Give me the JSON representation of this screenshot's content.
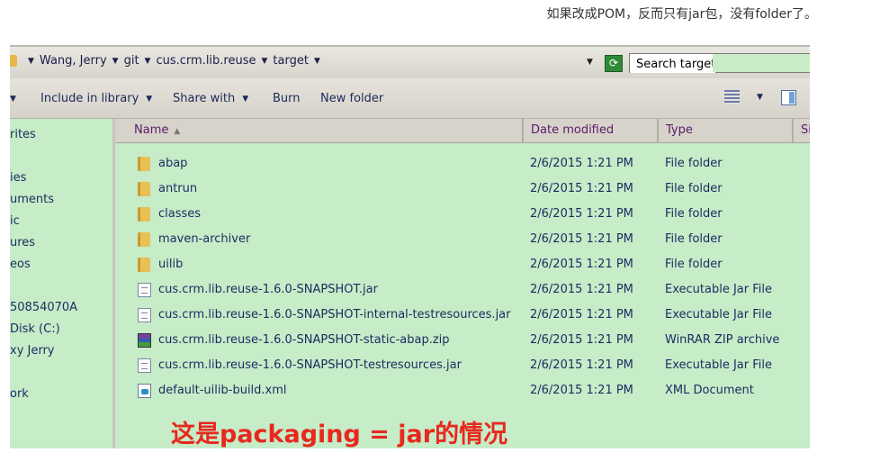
{
  "caption": "如果改成POM，反而只有jar包，没有folder了。",
  "address": {
    "crumbs": [
      "Wang, Jerry",
      "git",
      "cus.crm.lib.reuse",
      "target"
    ],
    "search_placeholder": "Search target"
  },
  "toolbar": {
    "include_in_library": "Include in library",
    "share_with": "Share with",
    "burn": "Burn",
    "new_folder": "New folder"
  },
  "nav": {
    "items": [
      "rites",
      "ies",
      "uments",
      "ic",
      "ures",
      "eos",
      "50854070A",
      "Disk (C:)",
      "xy Jerry",
      "ork"
    ]
  },
  "columns": {
    "name": "Name",
    "date": "Date modified",
    "type": "Type",
    "size": "Si"
  },
  "files": [
    {
      "name": "abap",
      "date": "2/6/2015 1:21 PM",
      "type": "File folder",
      "icon": "folder"
    },
    {
      "name": "antrun",
      "date": "2/6/2015 1:21 PM",
      "type": "File folder",
      "icon": "folder"
    },
    {
      "name": "classes",
      "date": "2/6/2015 1:21 PM",
      "type": "File folder",
      "icon": "folder"
    },
    {
      "name": "maven-archiver",
      "date": "2/6/2015 1:21 PM",
      "type": "File folder",
      "icon": "folder"
    },
    {
      "name": "uilib",
      "date": "2/6/2015 1:21 PM",
      "type": "File folder",
      "icon": "folder"
    },
    {
      "name": "cus.crm.lib.reuse-1.6.0-SNAPSHOT.jar",
      "date": "2/6/2015 1:21 PM",
      "type": "Executable Jar File",
      "icon": "jar"
    },
    {
      "name": "cus.crm.lib.reuse-1.6.0-SNAPSHOT-internal-testresources.jar",
      "date": "2/6/2015 1:21 PM",
      "type": "Executable Jar File",
      "icon": "jar"
    },
    {
      "name": "cus.crm.lib.reuse-1.6.0-SNAPSHOT-static-abap.zip",
      "date": "2/6/2015 1:21 PM",
      "type": "WinRAR ZIP archive",
      "icon": "zip"
    },
    {
      "name": "cus.crm.lib.reuse-1.6.0-SNAPSHOT-testresources.jar",
      "date": "2/6/2015 1:21 PM",
      "type": "Executable Jar File",
      "icon": "jar"
    },
    {
      "name": "default-uilib-build.xml",
      "date": "2/6/2015 1:21 PM",
      "type": "XML Document",
      "icon": "xml"
    }
  ],
  "overlay_text": "这是packaging = jar的情况",
  "colors": {
    "file_area_bg": "#c6ecc8",
    "overlay_text": "#e8281e",
    "header_text": "#5a1a6a"
  }
}
